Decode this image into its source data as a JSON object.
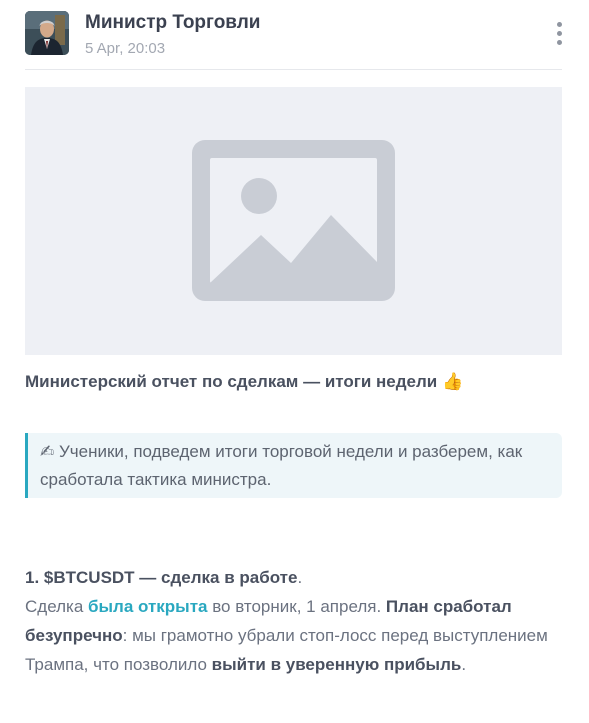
{
  "post": {
    "author": "Министр Торговли",
    "date": "5 Apr, 20:03",
    "title": "Министерский отчет по сделкам — итоги недели",
    "title_emoji": "👍",
    "quote": "✍ Ученики, подведем итоги торговой недели и разберем, как сработала тактика министра."
  },
  "section": {
    "heading": "1. $BTCUSDT — сделка в работе",
    "heading_end": ".",
    "p1": "Сделка ",
    "link": "была открыта",
    "p2": " во вторник, 1 апреля. ",
    "b1": "План сработал безупречно",
    "p3": ": мы грамотно убрали стоп-лосс перед выступлением Трампа, что позволило ",
    "b2": "выйти в уверенную прибыль",
    "p4": "."
  },
  "icons": {
    "more": "more-vertical-icon",
    "image": "image-placeholder-icon"
  },
  "colors": {
    "accent": "#2aa8c0",
    "placeholder_bg": "#eef0f5",
    "placeholder_icon": "#c9cdd5"
  }
}
